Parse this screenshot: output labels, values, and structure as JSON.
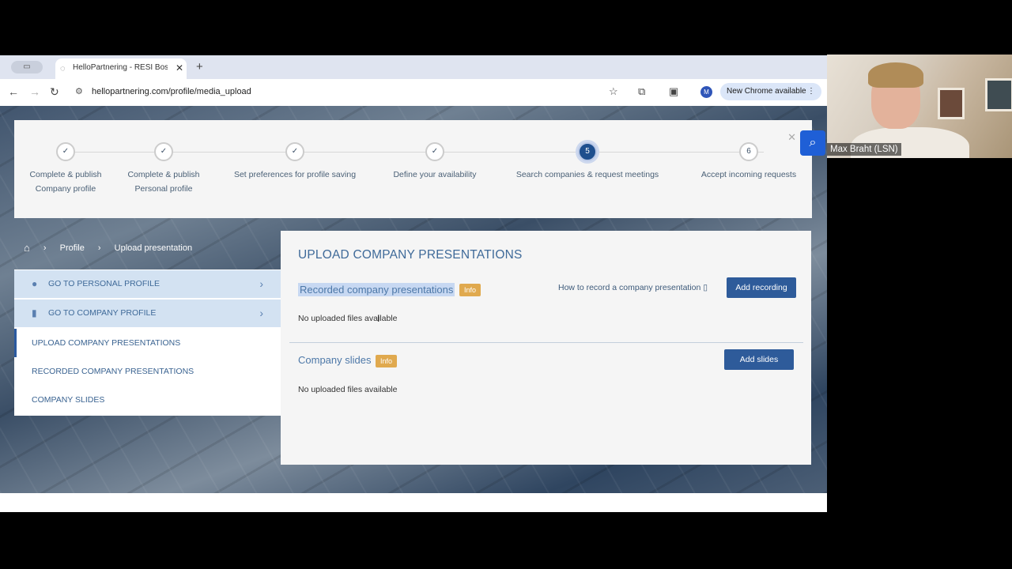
{
  "browser": {
    "tab_title": "HelloPartnering - RESI Boston",
    "url": "hellopartnering.com/profile/media_upload",
    "chrome_update": "New Chrome available",
    "avatar_initial": "M"
  },
  "steps": [
    {
      "marker": "✓",
      "label_lines": [
        "Complete & publish",
        "Company profile"
      ],
      "state": "done"
    },
    {
      "marker": "✓",
      "label_lines": [
        "Complete & publish",
        "Personal profile"
      ],
      "state": "done"
    },
    {
      "marker": "✓",
      "label_lines": [
        "Set preferences for profile saving"
      ],
      "state": "done"
    },
    {
      "marker": "✓",
      "label_lines": [
        "Define your availability"
      ],
      "state": "done"
    },
    {
      "marker": "5",
      "label_lines": [
        "Search companies & request meetings"
      ],
      "state": "active"
    },
    {
      "marker": "6",
      "label_lines": [
        "Accept incoming requests"
      ],
      "state": "todo"
    }
  ],
  "breadcrumb": {
    "items": [
      "Profile",
      "Upload presentation"
    ]
  },
  "sidebar": {
    "top_items": [
      {
        "label": "GO TO PERSONAL PROFILE",
        "icon": "person-icon"
      },
      {
        "label": "GO TO COMPANY PROFILE",
        "icon": "building-icon"
      }
    ],
    "sub_items": [
      {
        "label": "UPLOAD COMPANY PRESENTATIONS",
        "active": true
      },
      {
        "label": "RECORDED COMPANY PRESENTATIONS",
        "active": false
      },
      {
        "label": "COMPANY SLIDES",
        "active": false
      }
    ]
  },
  "main": {
    "title": "UPLOAD COMPANY PRESENTATIONS",
    "recorded": {
      "title": "Recorded company presentations",
      "badge": "Info",
      "howto": "How to record a company presentation",
      "button": "Add recording",
      "empty": "No uploaded files available"
    },
    "slides": {
      "title": "Company slides",
      "badge": "Info",
      "button": "Add slides",
      "empty": "No uploaded files available"
    }
  },
  "video": {
    "participant_name": "Max Braht (LSN)"
  },
  "colors": {
    "accent": "#2e5b9a",
    "badge": "#e0a94e",
    "menu_highlight": "#d3e2f2"
  }
}
